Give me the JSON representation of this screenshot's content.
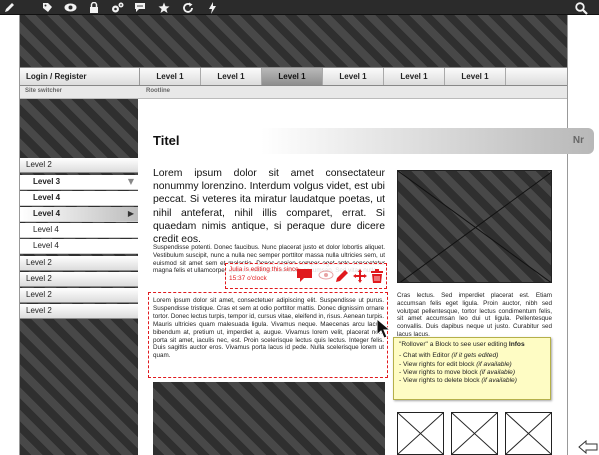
{
  "toolbar": {
    "icons": [
      "pencil-icon",
      "tag-icon",
      "eye-icon",
      "lock-icon",
      "settings-icon",
      "comment-icon",
      "star-icon",
      "refresh-icon",
      "bolt-icon"
    ],
    "search_icon": "search-icon"
  },
  "nav": {
    "login_label": "Login / Register",
    "items": [
      "Level 1",
      "Level 1",
      "Level 1",
      "Level 1",
      "Level 1",
      "Level 1"
    ],
    "active_index": 2
  },
  "subnav": {
    "site_switcher": "Site switcher",
    "rootline": "Rootline"
  },
  "sidebar": {
    "items": [
      {
        "label": "Level 2"
      },
      {
        "label": "Level 3"
      },
      {
        "label": "Level 4"
      },
      {
        "label": "Level 4"
      },
      {
        "label": "Level 4"
      },
      {
        "label": "Level 4"
      },
      {
        "label": "Level 2"
      },
      {
        "label": "Level 2"
      },
      {
        "label": "Level 2"
      },
      {
        "label": "Level 2"
      }
    ]
  },
  "page": {
    "title": "Titel",
    "number": "Nr",
    "lead": "Lorem ipsum dolor sit amet consectateur nonummy lorenzino. Interdum volgus videt, est ubi peccat. Si veteres ita miratur laudatque poetas, ut nihil anteferat, nihil illis comparet, errat. Si quaedam nimis antique, si peraque dure dicere credit eos.",
    "para2": "Suspendisse potenti. Donec faucibus. Nunc placerat justo et dolor lobortis aliquet. Vestibulum suscipit, nunc a nulla nec semper porttitor massa nulla ultricies sem, ut euismod sit amet sem et molestie. Donec sapien semper eget ante consectetur magna felis et ullamcorper quam. Vivamus bibendum accumsan. Sed vitae nulla.",
    "edit_text": "Lorem ipsum dolor sit amet, consectetuer adipiscing elit. Suspendisse ut purus. Suspendisse tristique. Cras et sem at odio porttitor mattis. Donec dignissim ornare tortor. Donec lectus turpis, tempor id, cursus vitae, eleifend in, risus. Aenean turpis. Mauris ultricies quam malesuada ligula. Vivamus neque. Maecenas arcu lacus, bibendum at, pretium ut, imperdiet a, augue. Vivamus lorem velit, placerat non, porta sit amet, iaculis nec, est. Proin scelerisque lectus quis lectus. Integer felis. Duis sagittis auctor eros. Vivamus porta lacus id pede. Nulla scelerisque lorem ut quam.",
    "right_text": "Cras lectus. Sed imperdiet placerat est. Etiam accumsan felis eget ligula. Proin auctor, nibh sed volutpat pellentesque, tortor lectus condimentum felis, sit amet accumsan leo dui ut ligula. Pellentesque convallis. Duis dapibus neque ut justo. Curabitur sed lacus lacus."
  },
  "editing": {
    "notice": "Julia is editing this since 15:37 o'clock",
    "accent_color": "#e0191d"
  },
  "tooltip": {
    "heading_pre": "\"Rollover\" a Block to see user editing ",
    "heading_bold": "Infos",
    "lines": [
      {
        "text": "- Chat with Editor ",
        "italic": "(if it gets edited)"
      },
      {
        "text": "- View rights for edit block ",
        "italic": "(if available)"
      },
      {
        "text": "- View rights to move block ",
        "italic": "(if available)"
      },
      {
        "text": "- View rights to delete block ",
        "italic": "(if available)"
      }
    ]
  }
}
